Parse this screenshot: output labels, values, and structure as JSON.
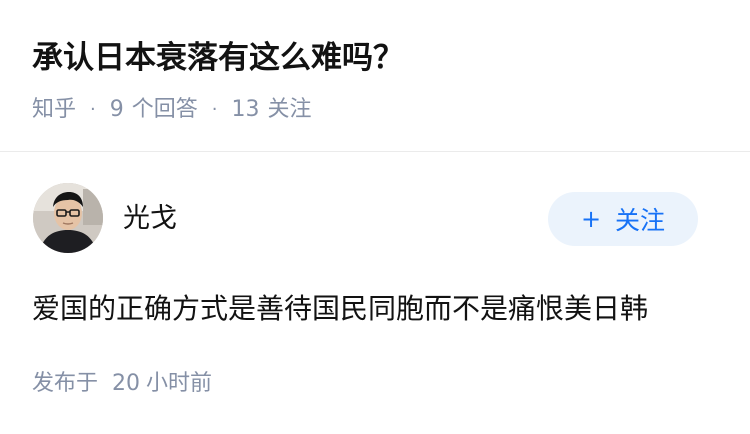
{
  "question": {
    "title": "承认日本衰落有这么难吗？",
    "source": "知乎",
    "answer_count": "9",
    "answer_label": "个回答",
    "follower_count": "13",
    "follower_label": "关注"
  },
  "answer": {
    "author": "光戈",
    "follow_label": "关注",
    "content": "爱国的正确方式是善待国民同胞而不是痛恨美日韩",
    "time_prefix": "发布于",
    "time_value": "20",
    "time_unit": "小时前"
  },
  "colors": {
    "accent": "#1772f6",
    "follow_bg": "#ebf3fc",
    "meta_text": "#8590a6"
  },
  "icons": {
    "avatar": "user-avatar-photo",
    "follow": "plus-icon"
  }
}
